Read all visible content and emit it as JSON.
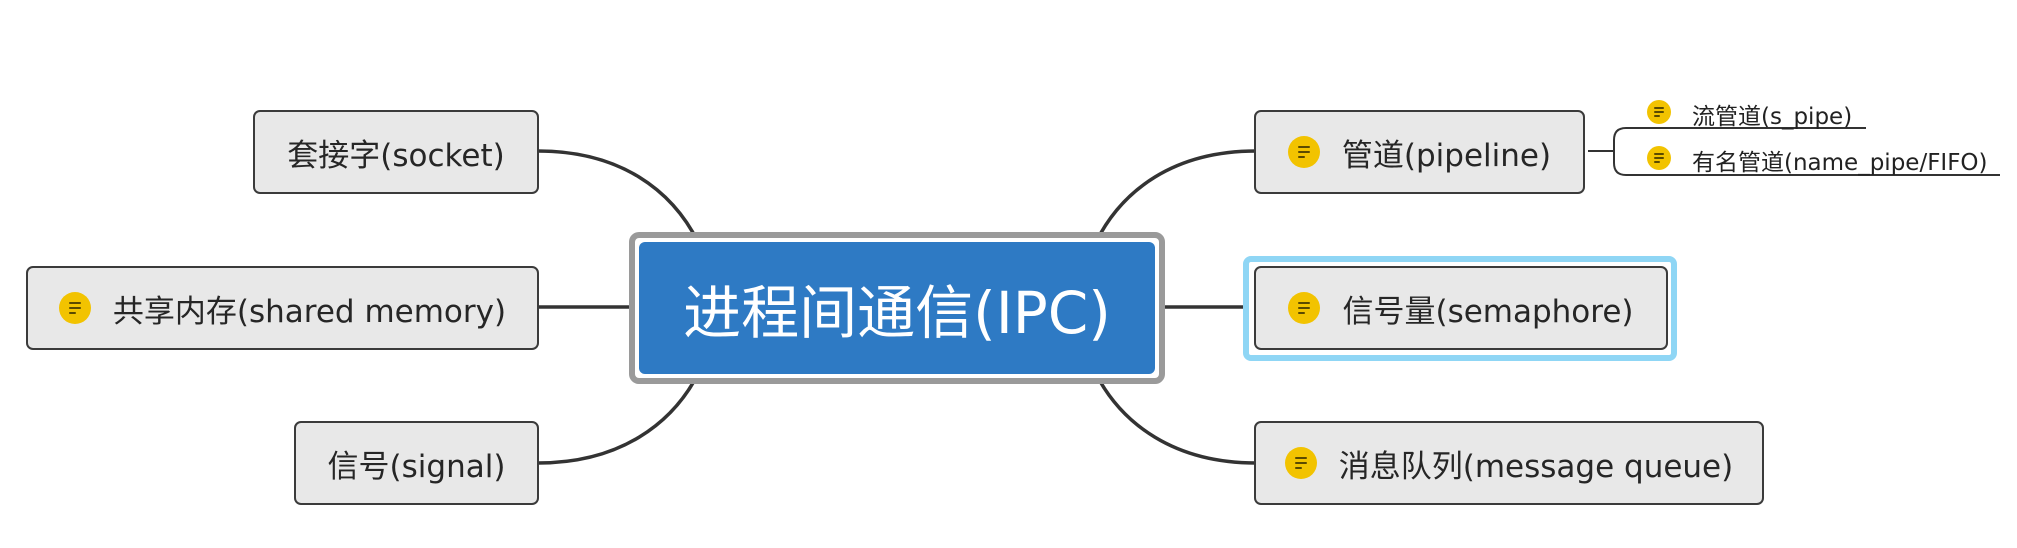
{
  "central": {
    "label": "进程间通信(IPC)"
  },
  "left_topics": [
    {
      "label": "套接字(socket)",
      "has_note": false
    },
    {
      "label": "共享内存(shared memory)",
      "has_note": true
    },
    {
      "label": "信号(signal)",
      "has_note": false
    }
  ],
  "right_topics": [
    {
      "label": "管道(pipeline)",
      "has_note": true
    },
    {
      "label": "信号量(semaphore)",
      "has_note": true,
      "selected": true
    },
    {
      "label": "消息队列(message queue)",
      "has_note": true
    }
  ],
  "pipeline_subtopics": [
    {
      "label": "流管道(s_pipe)",
      "has_note": true
    },
    {
      "label": "有名管道(name_pipe/FIFO)",
      "has_note": true
    }
  ],
  "colors": {
    "central_fill": "#2e7ac4",
    "node_fill": "#e8e8e8",
    "note_icon": "#f2c300",
    "selection": "#8fd6f5",
    "connector": "#333333"
  }
}
